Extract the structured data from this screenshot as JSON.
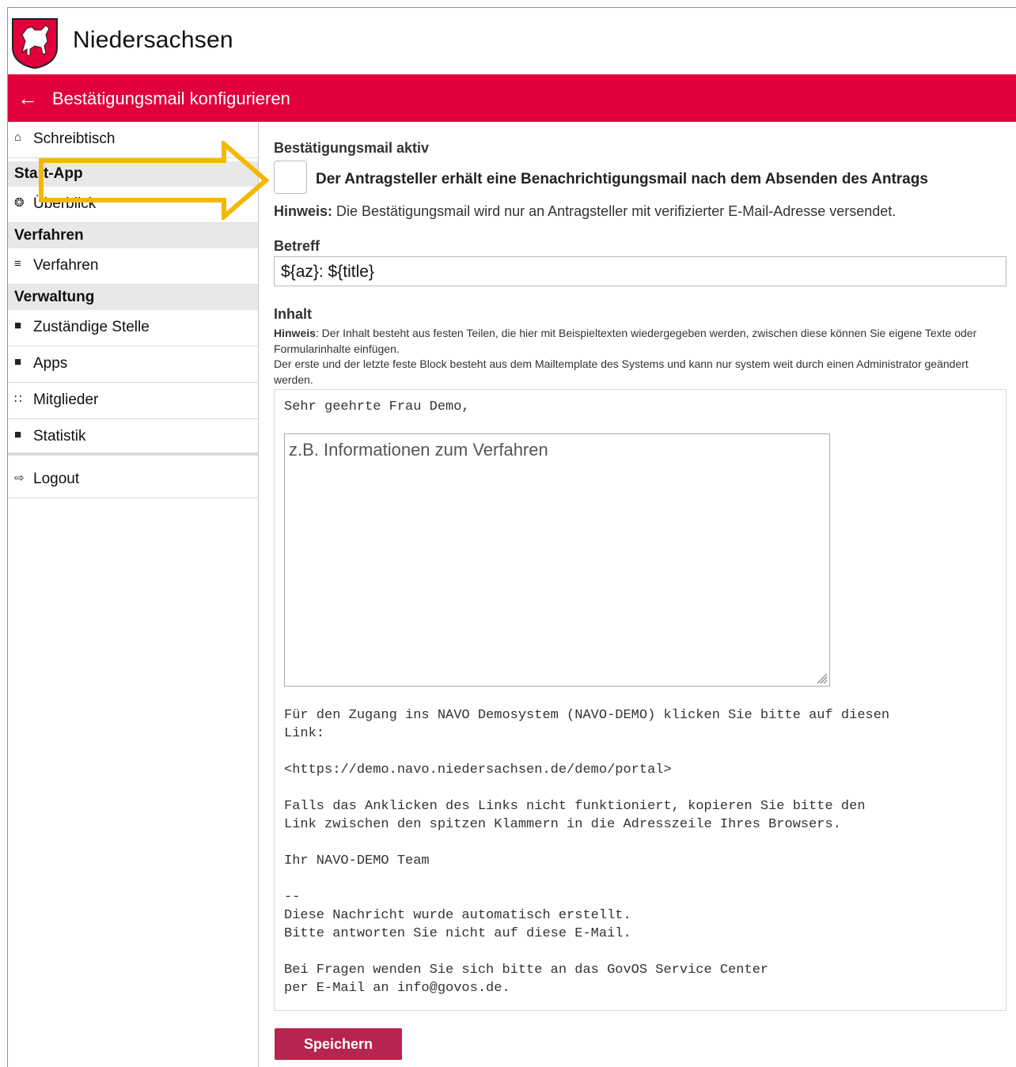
{
  "header": {
    "site_title": "Niedersachsen",
    "page_title": "Bestätigungsmail konfigurieren",
    "back_icon": "arrow-left-icon",
    "brand_red": "#e1003b"
  },
  "sidebar": {
    "items": [
      {
        "kind": "item",
        "icon": "home-icon",
        "glyph": "⌂",
        "label": "Schreibtisch"
      },
      {
        "kind": "head",
        "label": "Start-App"
      },
      {
        "kind": "item",
        "icon": "lightbulb-icon",
        "glyph": "❂",
        "label": "Überblick"
      },
      {
        "kind": "head",
        "label": "Verfahren"
      },
      {
        "kind": "item",
        "icon": "list-icon",
        "glyph": "≡",
        "label": "Verfahren"
      },
      {
        "kind": "head",
        "label": "Verwaltung"
      },
      {
        "kind": "item",
        "icon": "building-icon",
        "glyph": "■",
        "label": "Zuständige Stelle"
      },
      {
        "kind": "item",
        "icon": "apps-icon",
        "glyph": "■",
        "label": "Apps"
      },
      {
        "kind": "item",
        "icon": "users-icon",
        "glyph": "∷",
        "label": "Mitglieder"
      },
      {
        "kind": "item",
        "icon": "statistics-icon",
        "glyph": "■",
        "label": "Statistik"
      },
      {
        "kind": "item",
        "icon": "logout-icon",
        "glyph": "⇨",
        "label": "Logout"
      }
    ]
  },
  "form": {
    "active_label": "Bestätigungsmail aktiv",
    "checkbox_checked": false,
    "checkbox_text": "Der Antragsteller erhält eine Benachrichtigungsmail nach dem Absenden des Antrags",
    "hint_prefix": "Hinweis:",
    "hint_text": " Die Bestätigungsmail wird nur an Antragsteller mit verifizierter E-Mail-Adresse versendet.",
    "subject_label": "Betreff",
    "subject_value": "${az}: ${title}",
    "content_label": "Inhalt",
    "content_hint_prefix": "Hinweis",
    "content_hint_line1": ": Der Inhalt besteht aus festen Teilen, die hier mit Beispieltexten wiedergegeben werden, zwischen diese können Sie eigene Texte oder Formularinhalte einfügen.",
    "content_hint_line2": "Der erste und der letzte feste Block besteht aus dem Mailtemplate des Systems und kann nur system weit durch einen Administrator geändert werden.",
    "salutation": "Sehr geehrte Frau Demo,",
    "textarea_placeholder": "z.B. Informationen zum Verfahren",
    "mail_body": "Für den Zugang ins NAVO Demosystem (NAVO-DEMO) klicken Sie bitte auf diesen\nLink:\n\n<https://demo.navo.niedersachsen.de/demo/portal>\n\nFalls das Anklicken des Links nicht funktioniert, kopieren Sie bitte den\nLink zwischen den spitzen Klammern in die Adresszeile Ihres Browsers.\n\nIhr NAVO-DEMO Team\n\n--\nDiese Nachricht wurde automatisch erstellt.\nBitte antworten Sie nicht auf diese E-Mail.\n\nBei Fragen wenden Sie sich bitte an das GovOS Service Center\nper E-Mail an info@govos.de.",
    "save_label": "Speichern",
    "save_color": "#b7244f"
  },
  "annotation": {
    "arrow_color": "#f5b800"
  }
}
